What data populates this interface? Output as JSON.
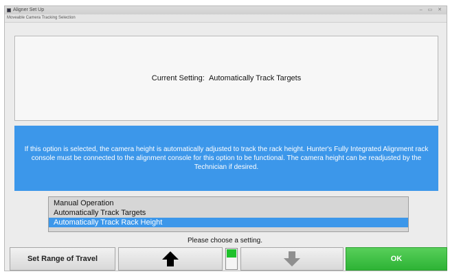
{
  "window": {
    "title": "Aligner Set Up",
    "subtitle": "Moveable Camera Tracking Selection",
    "controls": "– ▭ ✕"
  },
  "current": {
    "label": "Current Setting:",
    "value": "Automatically Track Targets"
  },
  "info": {
    "text": "If this option is selected, the camera height is automatically adjusted to track the rack height. Hunter's Fully Integrated Alignment rack console must be connected to the alignment console for this option to be functional.  The camera height can be readjusted by the Technician if desired."
  },
  "options": [
    {
      "label": "Manual Operation",
      "selected": false
    },
    {
      "label": "Automatically Track Targets",
      "selected": false
    },
    {
      "label": "Automatically Track Rack Height",
      "selected": true
    }
  ],
  "prompt": "Please choose a setting.",
  "buttons": {
    "range": "Set Range of Travel",
    "up_icon": "arrow-up-icon",
    "down_icon": "arrow-down-icon",
    "ok": "OK"
  },
  "indicator": {
    "level_fraction": 0.45,
    "color": "#1fc12c"
  },
  "colors": {
    "accent": "#3c97ea",
    "ok": "#2db335"
  }
}
